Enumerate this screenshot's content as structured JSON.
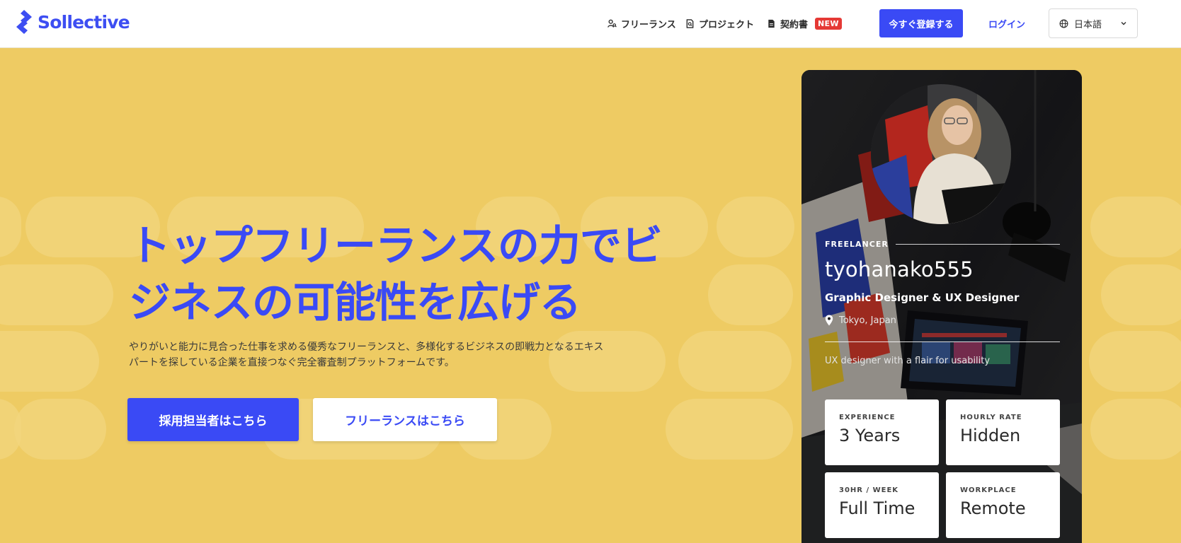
{
  "brand": {
    "name": "Sollective",
    "color": "#3d4ef2"
  },
  "nav": {
    "freelance": {
      "label": "フリーランス",
      "icon": "user-search-icon"
    },
    "project": {
      "label": "プロジェクト",
      "icon": "document-search-icon"
    },
    "contract": {
      "label": "契約書",
      "icon": "document-icon",
      "badge": "NEW"
    },
    "register_label": "今すぐ登録する",
    "login_label": "ログイン",
    "language": {
      "selected": "日本語",
      "icon": "globe-icon"
    }
  },
  "hero": {
    "title_line1": "トップフリーランスの力でビ",
    "title_line2": "ジネスの可能性を広げる",
    "desc_line1": "やりがいと能力に見合った仕事を求める優秀なフリーランスと、多様化するビジネスの即戦力となるエキス",
    "desc_line2": "パートを探している企業を直接つなぐ完全審査制プラットフォームです。",
    "employer_button": "採用担当者はこちら",
    "freelancer_button": "フリーランスはこちら"
  },
  "profile_card": {
    "label": "FREELANCER",
    "username": "tyohanako555",
    "role": "Graphic Designer  &  UX Designer",
    "location": "Tokyo, Japan",
    "tagline": "UX designer with a flair for usability",
    "stats": [
      {
        "label": "EXPERIENCE",
        "value": "3 Years"
      },
      {
        "label": "HOURLY RATE",
        "value": "Hidden"
      },
      {
        "label": "30HR / WEEK",
        "value": "Full Time"
      },
      {
        "label": "WORKPLACE",
        "value": "Remote"
      }
    ]
  },
  "colors": {
    "accent": "#3a4af5",
    "background": "#eecb63",
    "badge": "#e53935"
  }
}
